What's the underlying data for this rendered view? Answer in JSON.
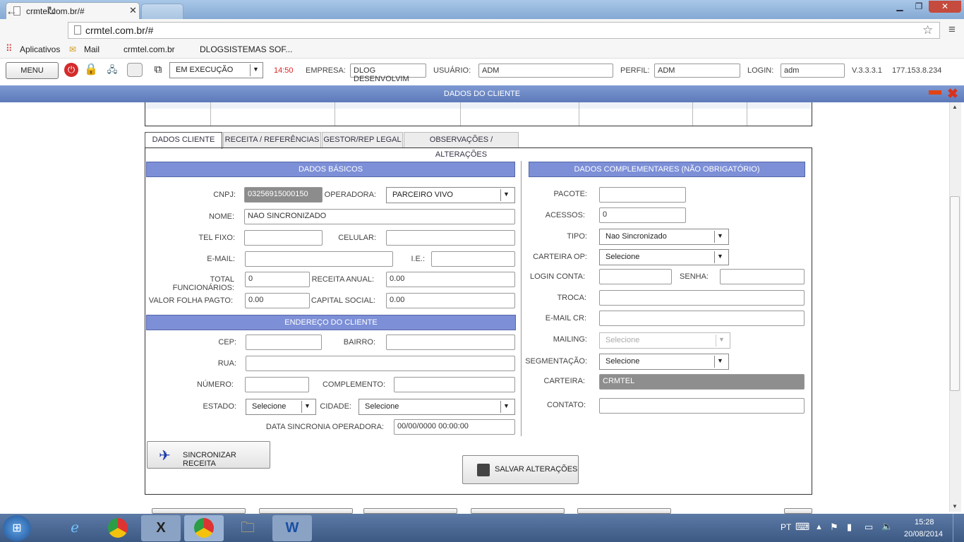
{
  "browser": {
    "tab_title": "crmtel.com.br/#",
    "url": "crmtel.com.br/#",
    "bookmarks": [
      "Aplicativos",
      "Mail",
      "crmtel.com.br",
      "DLOGSISTEMAS SOF..."
    ]
  },
  "appbar": {
    "menu_label": "MENU",
    "status_value": "EM EXECUÇÃO",
    "time": "14:50",
    "empresa_label": "EMPRESA:",
    "empresa_value": "DLOG DESENVOLVIM",
    "usuario_label": "USUÁRIO:",
    "usuario_value": "ADM",
    "perfil_label": "PERFIL:",
    "perfil_value": "ADM",
    "login_label": "LOGIN:",
    "login_value": "adm",
    "version": "V.3.3.3.1",
    "ip": "177.153.8.234"
  },
  "dialog": {
    "title": "DADOS DO CLIENTE"
  },
  "tabs": [
    "DADOS CLIENTE",
    "RECEITA / REFERÊNCIAS",
    "GESTOR/REP LEGAL",
    "OBSERVAÇÕES / ALTERAÇÕES"
  ],
  "basicos": {
    "header": "DADOS BÁSICOS",
    "cnpj_label": "CNPJ:",
    "cnpj": "03256915000150",
    "operadora_label": "OPERADORA:",
    "operadora": "PARCEIRO VIVO",
    "nome_label": "NOME:",
    "nome": "NAO SINCRONIZADO",
    "telfixo_label": "TEL FIXO:",
    "telfixo": "",
    "celular_label": "CELULAR:",
    "celular": "",
    "email_label": "E-MAIL:",
    "email": "",
    "ie_label": "I.E.:",
    "ie": "",
    "func_label": "TOTAL FUNCIONÁRIOS:",
    "func": "0",
    "receita_label": "RECEITA ANUAL:",
    "receita": "0.00",
    "folha_label": "VALOR FOLHA PAGTO:",
    "folha": "0.00",
    "capital_label": "CAPITAL SOCIAL:",
    "capital": "0.00"
  },
  "endereco": {
    "header": "ENDEREÇO DO CLIENTE",
    "cep_label": "CEP:",
    "cep": "",
    "bairro_label": "BAIRRO:",
    "bairro": "",
    "rua_label": "RUA:",
    "rua": "",
    "numero_label": "NÚMERO:",
    "numero": "",
    "complemento_label": "COMPLEMENTO:",
    "complemento": "",
    "estado_label": "ESTADO:",
    "estado": "Selecione",
    "cidade_label": "CIDADE:",
    "cidade": "Selecione",
    "sync_label": "DATA SINCRONIA OPERADORA:",
    "sync": "00/00/0000 00:00:00"
  },
  "complementares": {
    "header": "DADOS COMPLEMENTARES (NÃO OBRIGATÓRIO)",
    "pacote_label": "PACOTE:",
    "pacote": "",
    "acessos_label": "ACESSOS:",
    "acessos": "0",
    "tipo_label": "TIPO:",
    "tipo": "Nao Sincronizado",
    "carteira_op_label": "CARTEIRA OP:",
    "carteira_op": "Selecione",
    "login_conta_label": "LOGIN CONTA:",
    "login_conta": "",
    "senha_label": "SENHA:",
    "senha": "",
    "troca_label": "TROCA:",
    "troca": "",
    "email_cr_label": "E-MAIL CR:",
    "email_cr": "",
    "mailing_label": "MAILING:",
    "mailing": "Selecione",
    "segmentacao_label": "SEGMENTAÇÃO:",
    "segmentacao": "Selecione",
    "carteira_label": "CARTEIRA:",
    "carteira": "CRMTEL",
    "contato_label": "CONTATO:",
    "contato": ""
  },
  "buttons": {
    "sincronizar": "SINCRONIZAR RECEITA",
    "salvar": "SALVAR ALTERAÇÕES"
  },
  "taskbar": {
    "lang": "PT",
    "time": "15:28",
    "date": "20/08/2014"
  }
}
